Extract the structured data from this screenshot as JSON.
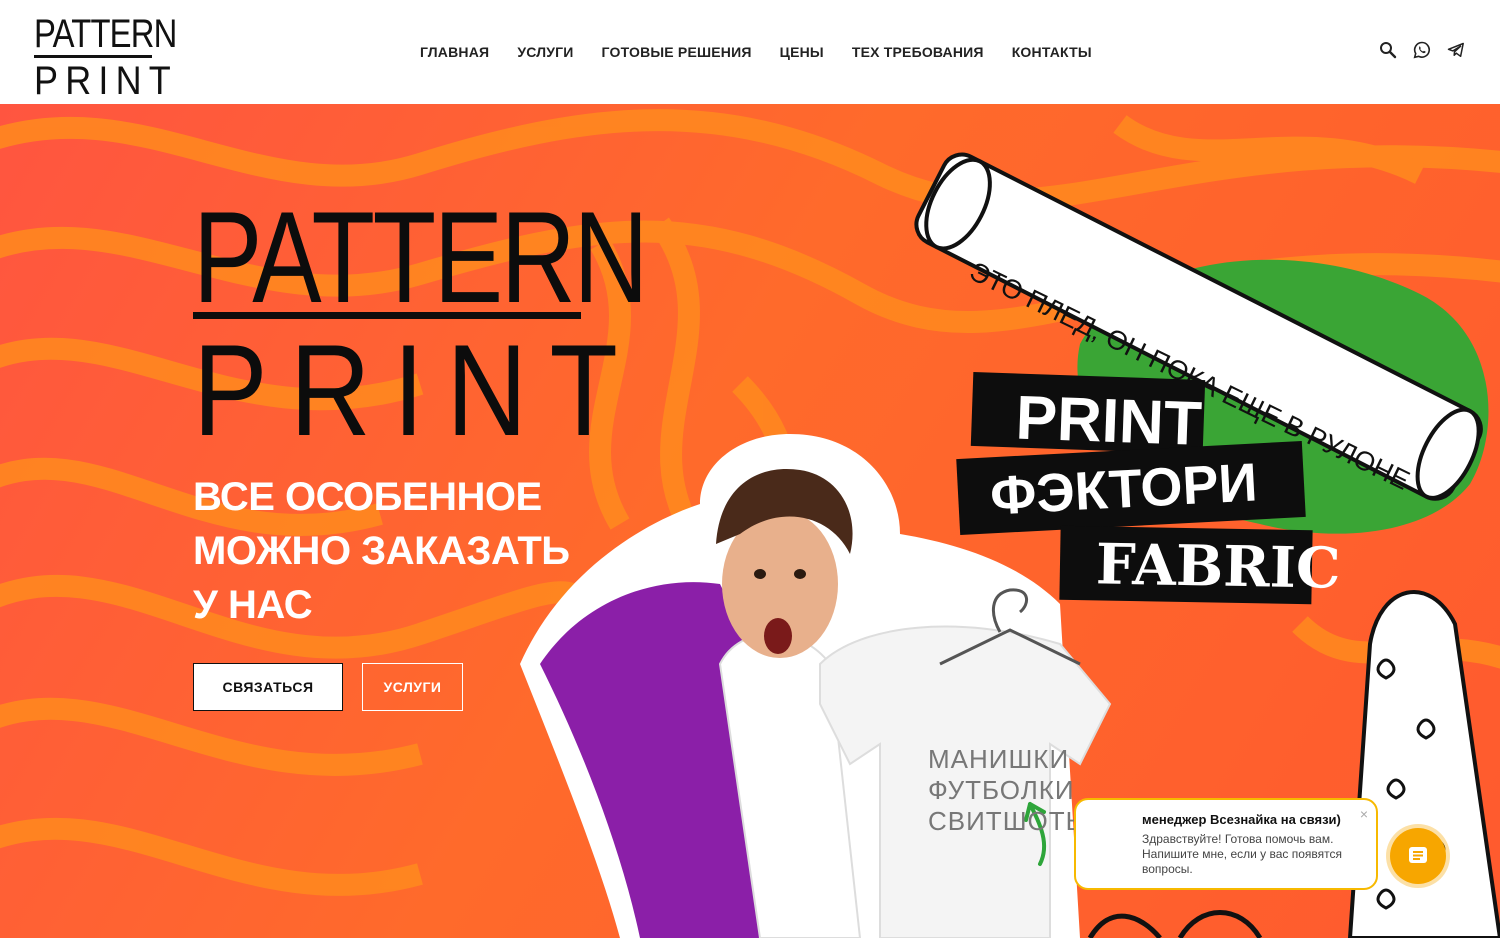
{
  "header": {
    "logo": {
      "line1": "PATTERN",
      "line2": "PRINT"
    },
    "nav": [
      {
        "label": "ГЛАВНАЯ"
      },
      {
        "label": "УСЛУГИ"
      },
      {
        "label": "ГОТОВЫЕ РЕШЕНИЯ"
      },
      {
        "label": "ЦЕНЫ"
      },
      {
        "label": "ТЕХ ТРЕБОВАНИЯ"
      },
      {
        "label": "КОНТАКТЫ"
      }
    ],
    "icons": [
      "search-icon",
      "whatsapp-icon",
      "telegram-icon"
    ]
  },
  "hero": {
    "logo": {
      "line1": "PATTERN",
      "line2": "PRINT"
    },
    "tagline": [
      "ВСЕ ОСОБЕННОЕ",
      "МОЖНО ЗАКАЗАТЬ",
      "У НАС"
    ],
    "buttons": {
      "contact": "СВЯЗАТЬСЯ",
      "services": "УСЛУГИ"
    },
    "roll_text": "ЭТО ПЛЕД, ОН ПОКА ЕЩЕ В РУЛОНЕ",
    "stickers": {
      "print": "PRINT",
      "factory": "ФЭКТОРИ",
      "fabric": "FABRIC"
    },
    "shirt_text": [
      "МАНИШКИ",
      "ФУТБОЛКИ",
      "СВИТШОТЫ"
    ]
  },
  "chat": {
    "title": "менеджер Всезнайка на связи)",
    "message": "Здравствуйте! Готова помочь вам. Напишите мне, если у вас появятся вопросы.",
    "close": "×"
  },
  "colors": {
    "hero_bg": "#ff5f35",
    "wave": "#ff8a1e",
    "green_blob": "#3aa535",
    "purple_shirt": "#8b1fa8",
    "chat_accent": "#f7a600"
  }
}
